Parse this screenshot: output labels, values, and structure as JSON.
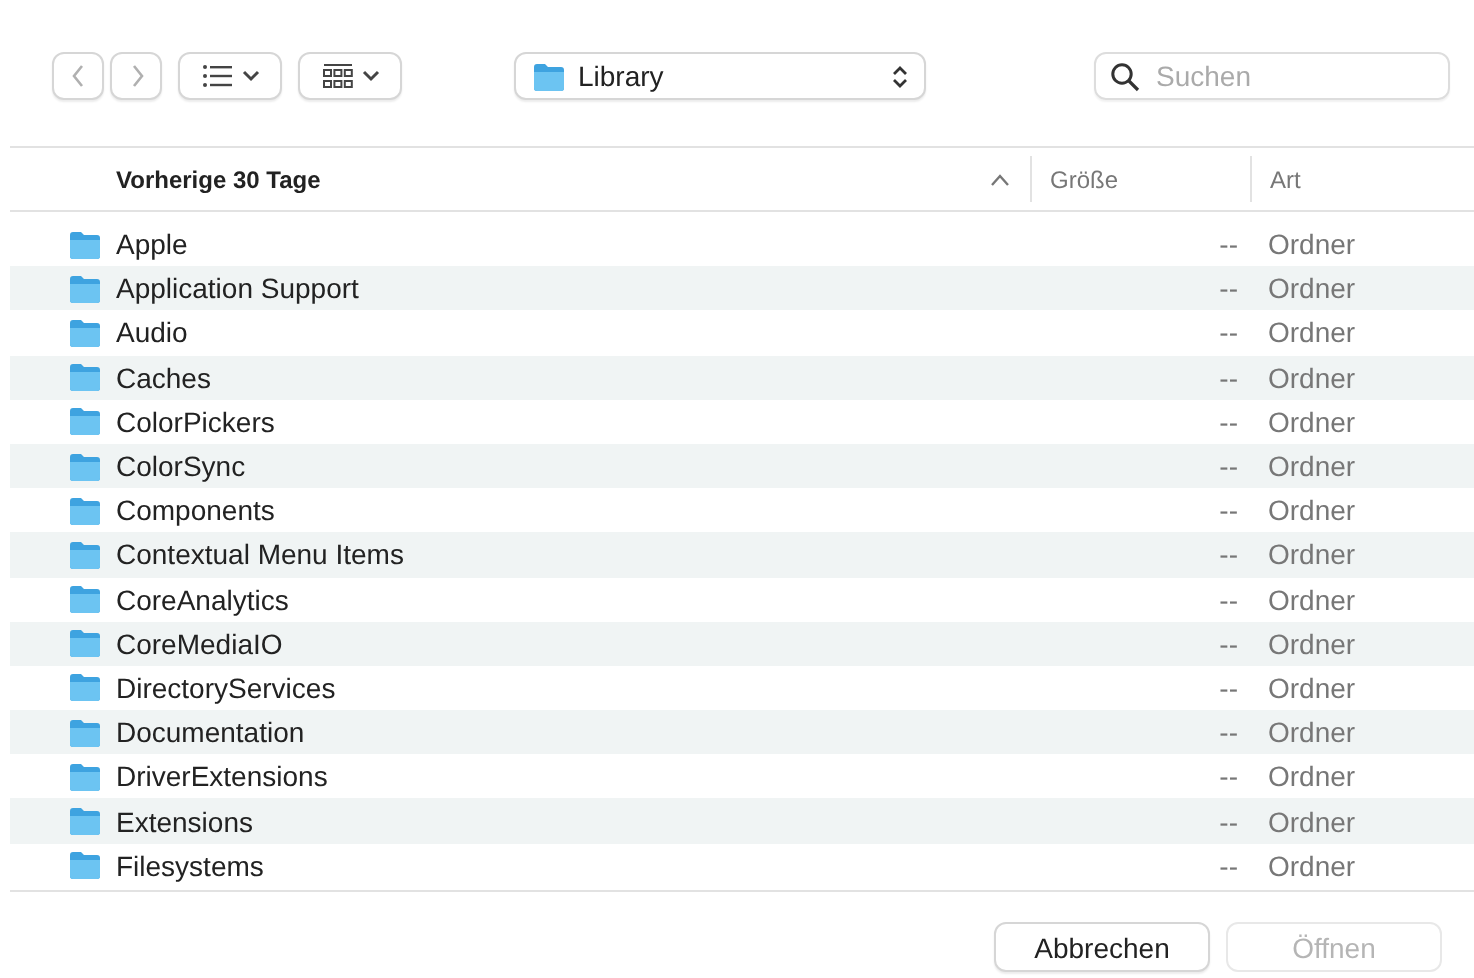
{
  "toolbar": {
    "nav_buttons": [
      {
        "kind": "back",
        "disabled": true
      },
      {
        "kind": "forward",
        "disabled": true
      }
    ],
    "location": "Library",
    "search": {
      "placeholder": "Suchen"
    }
  },
  "columns": [
    {
      "label": "Vorherige 30 Tage",
      "sorted": true
    },
    {
      "label": "Größe",
      "sorted": false
    },
    {
      "label": "Art",
      "sorted": false
    }
  ],
  "rows": [
    {
      "name": "Apple",
      "size": "--",
      "kind": "Ordner"
    },
    {
      "name": "Application Support",
      "size": "--",
      "kind": "Ordner"
    },
    {
      "name": "Audio",
      "size": "--",
      "kind": "Ordner"
    },
    {
      "name": "Caches",
      "size": "--",
      "kind": "Ordner"
    },
    {
      "name": "ColorPickers",
      "size": "--",
      "kind": "Ordner"
    },
    {
      "name": "ColorSync",
      "size": "--",
      "kind": "Ordner"
    },
    {
      "name": "Components",
      "size": "--",
      "kind": "Ordner"
    },
    {
      "name": "Contextual Menu Items",
      "size": "--",
      "kind": "Ordner"
    },
    {
      "name": "CoreAnalytics",
      "size": "--",
      "kind": "Ordner"
    },
    {
      "name": "CoreMediaIO",
      "size": "--",
      "kind": "Ordner"
    },
    {
      "name": "DirectoryServices",
      "size": "--",
      "kind": "Ordner"
    },
    {
      "name": "Documentation",
      "size": "--",
      "kind": "Ordner"
    },
    {
      "name": "DriverExtensions",
      "size": "--",
      "kind": "Ordner"
    },
    {
      "name": "Extensions",
      "size": "--",
      "kind": "Ordner"
    },
    {
      "name": "Filesystems",
      "size": "--",
      "kind": "Ordner"
    }
  ],
  "buttons": [
    {
      "label": "Abbrechen",
      "disabled": false
    },
    {
      "label": "Öffnen",
      "disabled": true
    }
  ]
}
